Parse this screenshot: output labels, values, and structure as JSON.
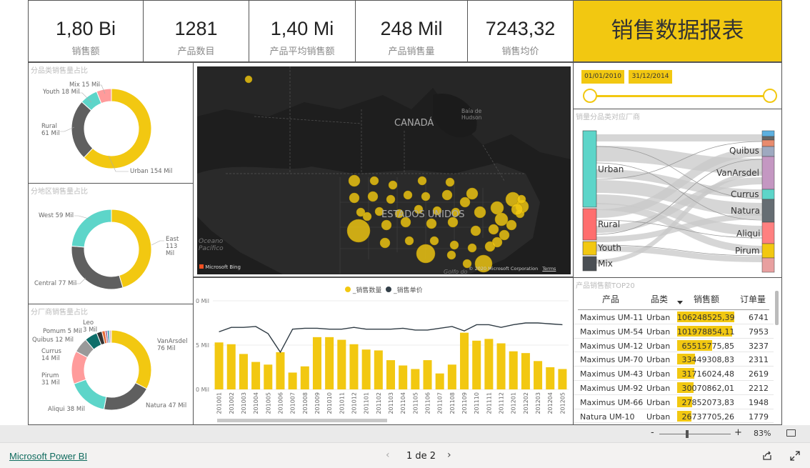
{
  "kpis": [
    {
      "value": "1,80 Bi",
      "label": "销售额"
    },
    {
      "value": "1281",
      "label": "产品数目"
    },
    {
      "value": "1,40 Mi",
      "label": "产品平均销售额"
    },
    {
      "value": "248 Mil",
      "label": "产品销售量"
    },
    {
      "value": "7243,32",
      "label": "销售均价"
    }
  ],
  "report_title": "销售数据报表",
  "colors": {
    "accent": "#F2C811",
    "teal": "#5DD5C9",
    "grey": "#5F5F5F",
    "pink": "#FF9B9B"
  },
  "donut_category": {
    "title": "分品类销售量占比",
    "slices": [
      {
        "name": "Urban",
        "label": "Urban 154 Mil",
        "value": 154,
        "color": "#F2C811"
      },
      {
        "name": "Rural",
        "label": "Rural 61 Mil",
        "value": 61,
        "color": "#5F5F5F"
      },
      {
        "name": "Youth",
        "label": "Youth 18 Mil",
        "value": 18,
        "color": "#5DD5C9"
      },
      {
        "name": "Mix",
        "label": "Mix 15 Mil",
        "value": 15,
        "color": "#FF9B9B"
      }
    ]
  },
  "donut_region": {
    "title": "分地区销售量占比",
    "slices": [
      {
        "name": "East",
        "label": "East 113 Mil",
        "value": 113,
        "color": "#F2C811"
      },
      {
        "name": "Central",
        "label": "Central 77 Mil",
        "value": 77,
        "color": "#5F5F5F"
      },
      {
        "name": "West",
        "label": "West 59 Mil",
        "value": 59,
        "color": "#5DD5C9"
      }
    ]
  },
  "donut_maker": {
    "title": "分厂商销售量占比",
    "slices": [
      {
        "name": "VanArsdel",
        "label": "VanArsdel 76 Mil",
        "value": 76,
        "color": "#F2C811"
      },
      {
        "name": "Natura",
        "label": "Natura 47 Mil",
        "value": 47,
        "color": "#5F5F5F"
      },
      {
        "name": "Aliqui",
        "label": "Aliqui 38 Mil",
        "value": 38,
        "color": "#5DD5C9"
      },
      {
        "name": "Pirum",
        "label": "Pirum 31 Mil",
        "value": 31,
        "color": "#FF9B9B"
      },
      {
        "name": "Currus",
        "label": "Currus 14 Mil",
        "value": 14,
        "color": "#999999"
      },
      {
        "name": "Quibus",
        "label": "Quibus 12 Mil",
        "value": 12,
        "color": "#0E6E6A"
      },
      {
        "name": "Pomum",
        "label": "Pomum 5 Mil",
        "value": 5,
        "color": "#333333"
      },
      {
        "name": "Leo",
        "label": "Leo 3 Mil",
        "value": 3,
        "color": "#E66C37"
      },
      {
        "name": "o1",
        "label": "",
        "value": 2,
        "color": "#A66999"
      },
      {
        "name": "o2",
        "label": "",
        "value": 2,
        "color": "#3599B8"
      },
      {
        "name": "o3",
        "label": "",
        "value": 2,
        "color": "#DFBFBF"
      }
    ]
  },
  "map": {
    "label_canada": "CANADÁ",
    "label_us": "ESTADOS UNIDOS",
    "label_hudson": "Baía de Hudson",
    "label_ocean": "Oceano Pacífico",
    "label_gulf": "Golfo do",
    "bing": "Microsoft Bing",
    "copyright": "© 2020 Microsoft Corporation",
    "terms": "Terms"
  },
  "date_slicer": {
    "start": "01/01/2010",
    "end": "31/12/2014"
  },
  "sankey": {
    "title": "销量分品类对应厂商",
    "left": [
      "Urban",
      "Rural",
      "Youth",
      "Mix"
    ],
    "right": [
      "Quibus",
      "VanArsdel",
      "Currus",
      "Natura",
      "Aliqui",
      "Pirum"
    ]
  },
  "top20": {
    "title": "产品销售额TOP20",
    "headers": [
      "产品",
      "品类",
      "销售额",
      "订单量"
    ],
    "rows": [
      {
        "product": "Maximus UM-11",
        "cat": "Urban",
        "sales": "106248525,39",
        "sales_value": 106248525.39,
        "orders": "6741"
      },
      {
        "product": "Maximus UM-54",
        "cat": "Urban",
        "sales": "101978854,11",
        "sales_value": 101978854.11,
        "orders": "7953"
      },
      {
        "product": "Maximus UM-12",
        "cat": "Urban",
        "sales": "65515775,85",
        "sales_value": 65515775.85,
        "orders": "3237"
      },
      {
        "product": "Maximus UM-70",
        "cat": "Urban",
        "sales": "33449308,83",
        "sales_value": 33449308.83,
        "orders": "2311"
      },
      {
        "product": "Maximus UM-43",
        "cat": "Urban",
        "sales": "31716024,48",
        "sales_value": 31716024.48,
        "orders": "2619"
      },
      {
        "product": "Maximus UM-92",
        "cat": "Urban",
        "sales": "30070862,01",
        "sales_value": 30070862.01,
        "orders": "2212"
      },
      {
        "product": "Maximus UM-66",
        "cat": "Urban",
        "sales": "27852073,83",
        "sales_value": 27852073.83,
        "orders": "1948"
      },
      {
        "product": "Natura UM-10",
        "cat": "Urban",
        "sales": "26737705,26",
        "sales_value": 26737705.26,
        "orders": "1779"
      }
    ]
  },
  "chart_data": {
    "type": "bar",
    "legend": [
      "_销售数量",
      "_销售单价"
    ],
    "yticks": [
      "0 Mil",
      "5 Mil",
      "0 Mil"
    ],
    "categories": [
      "201001",
      "201002",
      "201003",
      "201004",
      "201005",
      "201006",
      "201007",
      "201008",
      "201009",
      "201010",
      "201011",
      "201012",
      "201101",
      "201102",
      "201103",
      "201104",
      "201105",
      "201106",
      "201107",
      "201108",
      "201109",
      "201110",
      "201111",
      "201112",
      "201201",
      "201202",
      "201203",
      "201204",
      "201205"
    ],
    "series": [
      {
        "name": "_销售数量",
        "type": "bar",
        "values": [
          5.3,
          5.1,
          4.0,
          3.1,
          2.8,
          4.2,
          1.9,
          2.6,
          5.9,
          5.9,
          5.6,
          5.1,
          4.5,
          4.4,
          3.3,
          2.7,
          2.3,
          3.3,
          1.8,
          2.8,
          6.4,
          5.5,
          5.7,
          5.2,
          4.3,
          4.1,
          3.2,
          2.5,
          2.3
        ]
      },
      {
        "name": "_销售单价",
        "type": "line",
        "values": [
          6.5,
          7.0,
          7.0,
          7.1,
          6.3,
          4.2,
          6.8,
          6.9,
          6.9,
          6.8,
          6.8,
          7.0,
          6.8,
          6.8,
          6.8,
          6.9,
          6.7,
          6.7,
          6.9,
          7.1,
          6.6,
          7.3,
          7.3,
          7.0,
          7.3,
          7.5,
          7.5,
          7.4,
          7.3
        ]
      }
    ],
    "ylim": [
      0,
      10
    ]
  },
  "footer": {
    "brand": "Microsoft Power BI",
    "page": "1 de 2",
    "zoom": "83%",
    "zoom_minus": "-",
    "zoom_plus": "+"
  }
}
